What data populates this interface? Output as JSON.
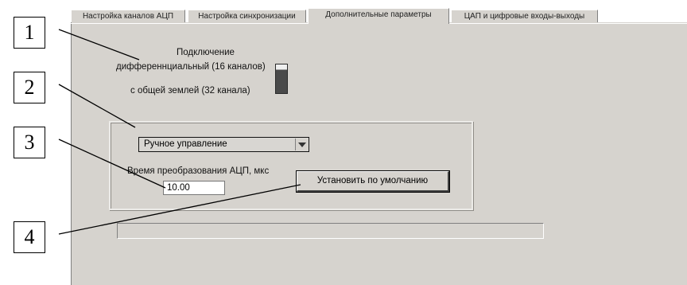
{
  "tabs": [
    {
      "label": "Настройка каналов АЦП"
    },
    {
      "label": "Настройка синхронизации"
    },
    {
      "label": "Дополнительные параметры"
    },
    {
      "label": "ЦАП и цифровые входы-выходы"
    }
  ],
  "active_tab": "Дополнительные параметры",
  "connection": {
    "title": "Подключение",
    "option_differential": "дифференнциальный (16 каналов)",
    "option_common_ground": "с  общей землей (32 канала)"
  },
  "mode_select": {
    "value": "Ручное управление"
  },
  "conversion_time": {
    "label": "Время преобразования АЦП, мкс",
    "value": "10.00"
  },
  "default_button": {
    "label": "Установить по умолчанию"
  },
  "callouts": [
    "1",
    "2",
    "3",
    "4"
  ]
}
